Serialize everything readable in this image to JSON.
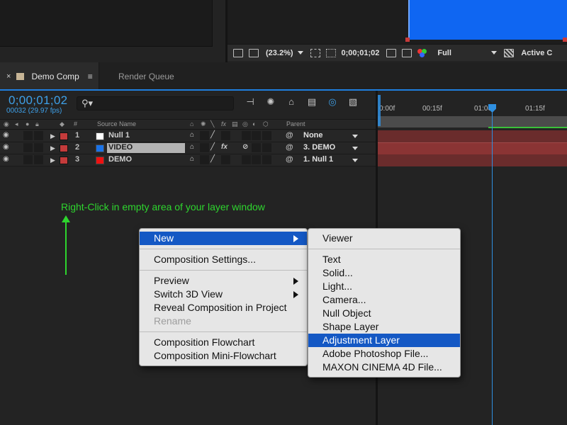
{
  "viewer_toolbar": {
    "zoom": "(23.2%)",
    "timecode": "0;00;01;02",
    "resolution": "Full",
    "camera": "Active C"
  },
  "tabs": [
    {
      "label": "Demo Comp",
      "close": "×",
      "menu": "≡"
    },
    {
      "label": "Render Queue"
    }
  ],
  "timeline": {
    "timecode": "0;00;01;02",
    "fps": "00032 (29.97 fps)",
    "search_glyph": "⚲▾",
    "columns": {
      "num": "#",
      "source_name": "Source Name",
      "parent": "Parent",
      "switches": "fx"
    },
    "layers": [
      {
        "num": "1",
        "name": "Null 1",
        "label_color": "#c43b3b",
        "swatch_color": "#ffffff",
        "parent": "None",
        "fx": ""
      },
      {
        "num": "2",
        "name": "VIDEO",
        "label_color": "#c43b3b",
        "swatch_color": "#1a73e8",
        "parent": "3. DEMO",
        "fx": "fx"
      },
      {
        "num": "3",
        "name": "DEMO",
        "label_color": "#c43b3b",
        "swatch_color": "#ee1111",
        "parent": "1. Null 1",
        "fx": ""
      }
    ],
    "ruler_ticks": [
      "0:00f",
      "00:15f",
      "01:00f",
      "01:15f"
    ]
  },
  "instruction": "Right-Click in empty area of your layer window",
  "context_menu": {
    "items": [
      {
        "label": "New",
        "submenu": true,
        "selected": true
      },
      {
        "separator": true
      },
      {
        "label": "Composition Settings..."
      },
      {
        "separator": true
      },
      {
        "label": "Preview",
        "submenu": true
      },
      {
        "label": "Switch 3D View",
        "submenu": true
      },
      {
        "label": "Reveal Composition in Project"
      },
      {
        "label": "Rename",
        "disabled": true
      },
      {
        "separator": true
      },
      {
        "label": "Composition Flowchart"
      },
      {
        "label": "Composition Mini-Flowchart"
      }
    ]
  },
  "submenu": {
    "items": [
      {
        "label": "Viewer"
      },
      {
        "separator": true
      },
      {
        "label": "Text"
      },
      {
        "label": "Solid..."
      },
      {
        "label": "Light..."
      },
      {
        "label": "Camera..."
      },
      {
        "label": "Null Object"
      },
      {
        "label": "Shape Layer"
      },
      {
        "label": "Adjustment Layer",
        "selected": true
      },
      {
        "label": "Adobe Photoshop File..."
      },
      {
        "label": "MAXON CINEMA 4D File..."
      }
    ]
  },
  "colors": {
    "accent_blue": "#1f7fe0",
    "menu_highlight": "#1458c4",
    "instruction_green": "#2ed52e",
    "layer_bar": "#8a3434"
  }
}
